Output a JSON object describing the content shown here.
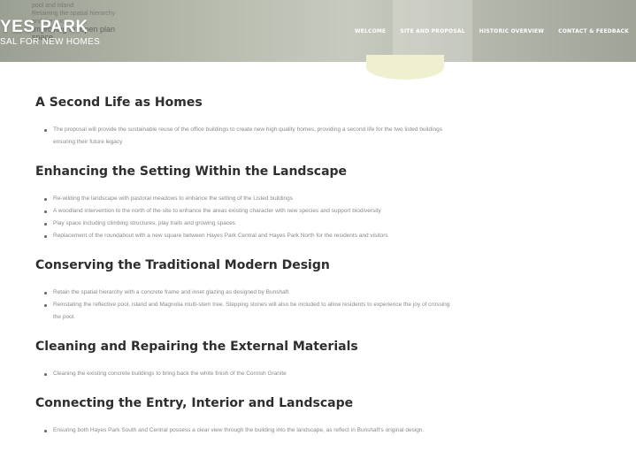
{
  "header": {
    "ghost_lines": [
      "pool and island",
      "Retaining the spatial hierarchy",
      "and the pool",
      "Improving an open plan",
      "space"
    ],
    "site_title": "YES PARK",
    "site_subtitle": "SAL FOR NEW HOMES"
  },
  "nav": {
    "items": [
      {
        "label": "WELCOME"
      },
      {
        "label": "SITE AND PROPOSAL"
      },
      {
        "label": "HISTORIC OVERVIEW"
      },
      {
        "label": "CONTACT & FEEDBACK"
      }
    ],
    "active_index": 1
  },
  "sections": [
    {
      "title": "A Second Life as Homes",
      "bullets": [
        "The proposal will provide the sustainable reuse of the office buildings to create new high quality homes, providing a second life for the two listed buildings",
        "ensuring their future legacy"
      ]
    },
    {
      "title": "Enhancing the Setting Within the Landscape",
      "bullets": [
        "Re-wilding the landscape with pastoral meadows to enhance the setting of the Listed buildings",
        "A woodland intervention to the north of the site to enhance the areas existing character with new species and support biodiversity",
        "Play space including climbing structures, play trails and growing spaces",
        "Replacement of the roundabout with a new square between Hayes Park Central and Hayes Park North for the residents and visitors"
      ]
    },
    {
      "title": "Conserving the Traditional Modern Design",
      "bullets": [
        "Retain the spatial hierarchy with a concrete frame and inset glazing as designed by Bunshaft",
        "Reinstating the reflective pool, island and Magnolia multi-stem tree. Stepping stones will also be included to allow residents to experience the joy of crossing",
        "the pool."
      ]
    },
    {
      "title": "Cleaning and Repairing the External Materials",
      "bullets": [
        "Cleaning the existing concrete buildings to bring back the white finish of the Cornish Granite"
      ]
    },
    {
      "title": "Connecting the Entry, Interior and Landscape",
      "bullets": [
        "Ensuring both Hayes Park South and Central possess a clear view through the building into the landscape, as reflect in Bunshaft's original design."
      ]
    }
  ],
  "colors": {
    "accent_blob": "#eef0cf",
    "nav_text": "#ffffff",
    "body_text": "#8a8a8a",
    "heading_text": "#2e2e2e"
  }
}
